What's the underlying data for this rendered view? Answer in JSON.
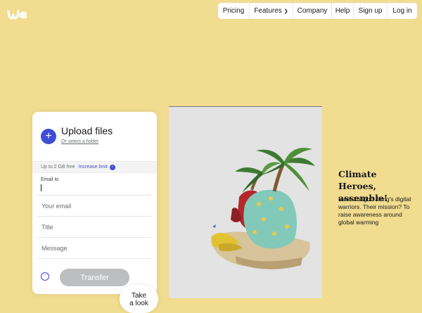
{
  "header": {
    "logo_icon": "wetransfer-logo",
    "nav": [
      {
        "label": "Pricing"
      },
      {
        "label": "Features",
        "icon": "chevron-down-icon"
      },
      {
        "label": "Company"
      },
      {
        "label": "Help"
      },
      {
        "label": "Sign up"
      },
      {
        "label": "Log in"
      }
    ]
  },
  "upload_panel": {
    "add_icon": "plus-icon",
    "title": "Upload files",
    "select_folder": "Or select a folder",
    "limit_text": "Up to 2 GB free",
    "limit_link": "Increase limit",
    "email_to_label": "Email to",
    "email_to_value": "",
    "your_email_placeholder": "Your email",
    "title_placeholder": "Title",
    "message_placeholder": "Message",
    "transfer_label": "Transfer",
    "accent_color": "#3f4cd6"
  },
  "take_look": {
    "label_line1": "Take",
    "label_line2": "a look"
  },
  "ad": {
    "title": "Climate Heroes, assemble!",
    "body": "Meet Zongbo Jiang's digital warriors. Their mission? To raise awareness around global warming"
  },
  "colors": {
    "background": "#f1dc8f",
    "button_disabled": "#bdbec0"
  }
}
